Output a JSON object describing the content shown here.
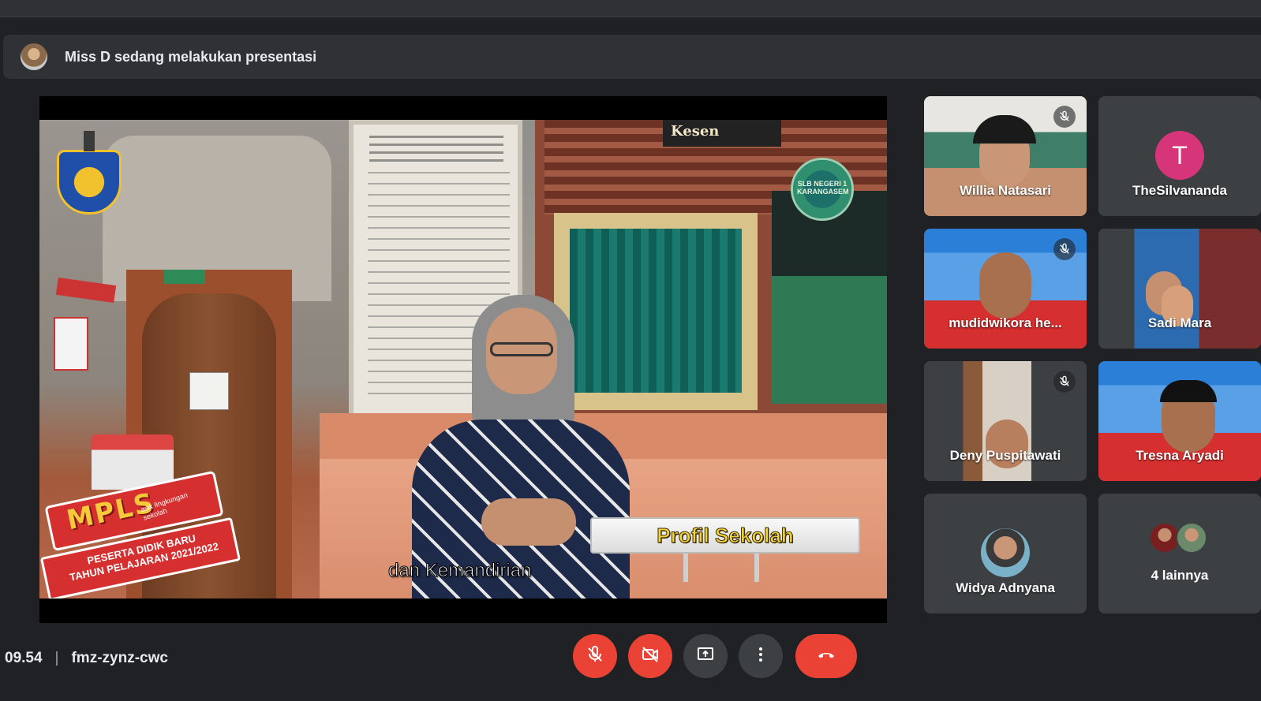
{
  "presenter_banner": {
    "text": "Miss D sedang melakukan presentasi"
  },
  "video": {
    "sign_text": "Kesen",
    "school_logo_text": "SLB NEGERI 1 KARANGASEM",
    "mpls": {
      "title": "MPLS",
      "tagline": "asik lingkungan sekolah",
      "ribbon_line1": "PESERTA DIDIK BARU",
      "ribbon_line2": "TAHUN PELAJARAN 2021/2022"
    },
    "profil_label": "Profil Sekolah",
    "caption": "dan Kemandirian"
  },
  "participants": [
    {
      "name": "Willia Natasari",
      "muted": true
    },
    {
      "name": "TheSilvananda",
      "avatar_letter": "T",
      "avatar_color": "#d6357a",
      "muted": true
    },
    {
      "name": "mudidwikora he...",
      "muted": true
    },
    {
      "name": "Sadi Mara",
      "muted": true
    },
    {
      "name": "Deny Puspitawati",
      "muted": true
    },
    {
      "name": "Tresna Aryadi",
      "muted": true
    },
    {
      "name": "Widya Adnyana",
      "muted": false
    },
    {
      "name": "4 lainnya",
      "muted": false
    }
  ],
  "meeting": {
    "time": "09.54",
    "separator": "|",
    "code": "fmz-zynz-cwc"
  },
  "controls": {
    "mic_icon": "mic-off-icon",
    "camera_icon": "camera-off-icon",
    "present_icon": "present-screen-icon",
    "more_icon": "more-vert-icon",
    "end_call_icon": "call-end-icon",
    "danger_color": "#ea4335",
    "neutral_color": "#3c4043"
  }
}
